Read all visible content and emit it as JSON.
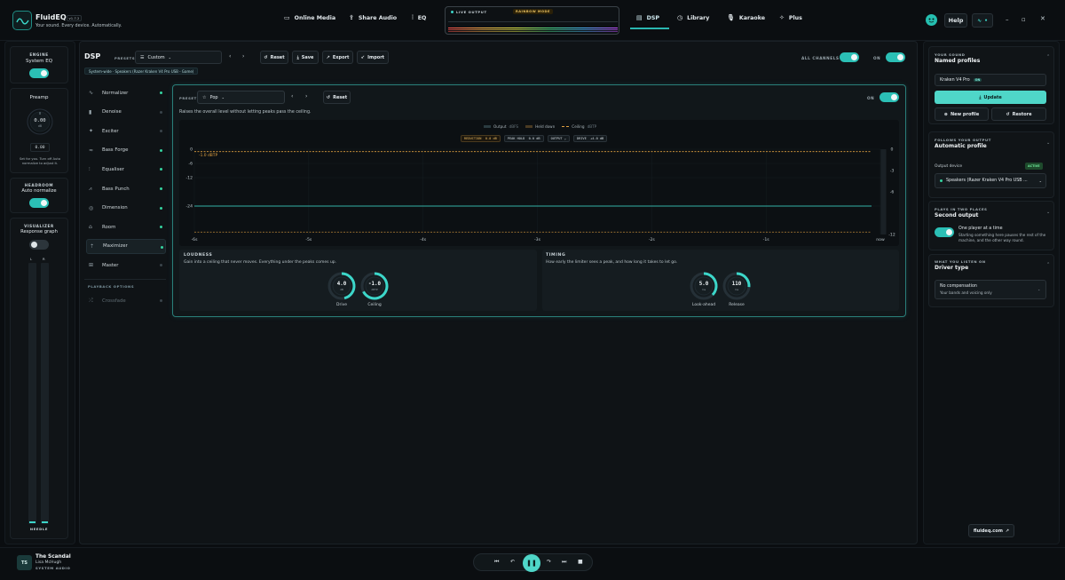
{
  "app": {
    "name": "FluidEQ",
    "version": "v1.7.2",
    "tagline": "Your sound. Every device. Automatically."
  },
  "nav": {
    "online_media": "Online Media",
    "share_audio": "Share Audio",
    "eq": "EQ",
    "dsp": "DSP",
    "library": "Library",
    "karaoke": "Karaoke",
    "plus": "Plus",
    "help": "Help"
  },
  "live": {
    "label": "LIVE OUTPUT",
    "mode": "RAINBOW MODE"
  },
  "left": {
    "engine_title": "ENGINE",
    "engine_sub": "System EQ",
    "preamp_title": "Preamp",
    "preamp_knob": "0.00",
    "preamp_unit": "dB",
    "preamp_value": "0.00",
    "preamp_note": "Set for you. Turn off Auto normalize to adjust it.",
    "headroom_title": "HEADROOM",
    "headroom_sub": "Auto normalize",
    "visualizer_title": "VISUALIZER",
    "visualizer_sub": "Response graph",
    "meter_l": "L",
    "meter_r": "R",
    "needle": "NEEDLE"
  },
  "dsp": {
    "title": "DSP",
    "presets_label": "PRESETS",
    "preset_value": "Custom",
    "reset": "Reset",
    "save": "Save",
    "export": "Export",
    "import": "Import",
    "all_channels": "ALL CHANNELS",
    "on": "ON",
    "device_path": "System-wide · Speakers (Razer Kraken V4 Pro USB - Game)",
    "modules": [
      {
        "label": "Normalizer",
        "icon": "normalizer-icon"
      },
      {
        "label": "Denoise",
        "icon": "denoise-icon"
      },
      {
        "label": "Exciter",
        "icon": "exciter-icon"
      },
      {
        "label": "Bass Forge",
        "icon": "bass-forge-icon"
      },
      {
        "label": "Equaliser",
        "icon": "equaliser-icon"
      },
      {
        "label": "Bass Punch",
        "icon": "bass-punch-icon"
      },
      {
        "label": "Dimension",
        "icon": "dimension-icon"
      },
      {
        "label": "Room",
        "icon": "room-icon"
      },
      {
        "label": "Maximizer",
        "icon": "maximizer-icon"
      },
      {
        "label": "Master",
        "icon": "master-icon"
      }
    ],
    "playback_options": "PLAYBACK OPTIONS",
    "crossfade": "Crossfade"
  },
  "maximizer": {
    "preset_label": "PRESET",
    "preset_value": "Pop",
    "reset": "Reset",
    "on": "ON",
    "description": "Raises the overall level without letting peaks pass the ceiling.",
    "legend_output": "Output",
    "legend_output_unit": "dBFS",
    "legend_held": "Held down",
    "legend_ceiling": "Ceiling",
    "legend_ceiling_unit": "dBTP",
    "stat_reduction_label": "REDUCTION",
    "stat_reduction_value": "0.0 dB",
    "stat_peak_label": "PEAK HOLD",
    "stat_peak_value": "0.0 dB",
    "stat_output_label": "OUTPUT",
    "stat_drive_label": "DRIVE",
    "stat_drive_value": "+4.0 dB",
    "ceiling_tag": "-1.0 dBTP",
    "loudness_title": "LOUDNESS",
    "loudness_desc": "Gain into a ceiling that never moves. Everything under the peaks comes up.",
    "timing_title": "TIMING",
    "timing_desc": "How early the limiter sees a peak, and how long it takes to let go.",
    "knobs": [
      {
        "label": "Drive",
        "value": "4.0",
        "unit": "dB",
        "fraction": 0.62
      },
      {
        "label": "Ceiling",
        "value": "-1.0",
        "unit": "dBTP",
        "fraction": 0.9
      },
      {
        "label": "Look-ahead",
        "value": "5.0",
        "unit": "ms",
        "fraction": 0.5
      },
      {
        "label": "Release",
        "value": "110",
        "unit": "ms",
        "fraction": 0.35
      }
    ]
  },
  "chart_data": {
    "type": "line",
    "x_ticks": [
      "-6s",
      "-5s",
      "-4s",
      "-3s",
      "-2s",
      "-1s",
      "now"
    ],
    "y_left_ticks": [
      "0",
      "-6",
      "-12",
      "-24"
    ],
    "y_right_ticks": [
      "0",
      "-3",
      "-6",
      "-12"
    ],
    "ylim": [
      -36,
      0
    ],
    "ceiling_db": -1.0,
    "floor_db": -35.0,
    "output_db": -24.0,
    "grid": true
  },
  "right": {
    "sound_caption": "YOUR SOUND",
    "sound_title": "Named profiles",
    "profile_name": "Kraken V4 Pro",
    "profile_badge": "ON",
    "update": "Update",
    "new_profile": "New profile",
    "restore": "Restore",
    "follows_caption": "FOLLOWS YOUR OUTPUT",
    "follows_title": "Automatic profile",
    "output_device_label": "Output device",
    "active_badge": "ACTIVE",
    "output_device_value": "Speakers (Razer Kraken V4 Pro USB ...",
    "two_places_caption": "PLAYS IN TWO PLACES",
    "two_places_title": "Second output",
    "one_player": "One player at a time",
    "one_player_desc": "Starting something here pauses the rest of the machine, and the other way round.",
    "listen_caption": "WHAT YOU LISTEN ON",
    "listen_title": "Driver type",
    "compensation_title": "No compensation",
    "compensation_desc": "Your bands and voicing only",
    "website": "fluideq.com"
  },
  "player": {
    "initials": "TS",
    "title": "The Scandal",
    "artist": "Lisa McHugh",
    "source": "SYSTEM AUDIO"
  },
  "colors": {
    "accent": "#2bbfb5",
    "background": "#0a0d10",
    "panel": "#101417",
    "ceiling": "#e0a040"
  }
}
